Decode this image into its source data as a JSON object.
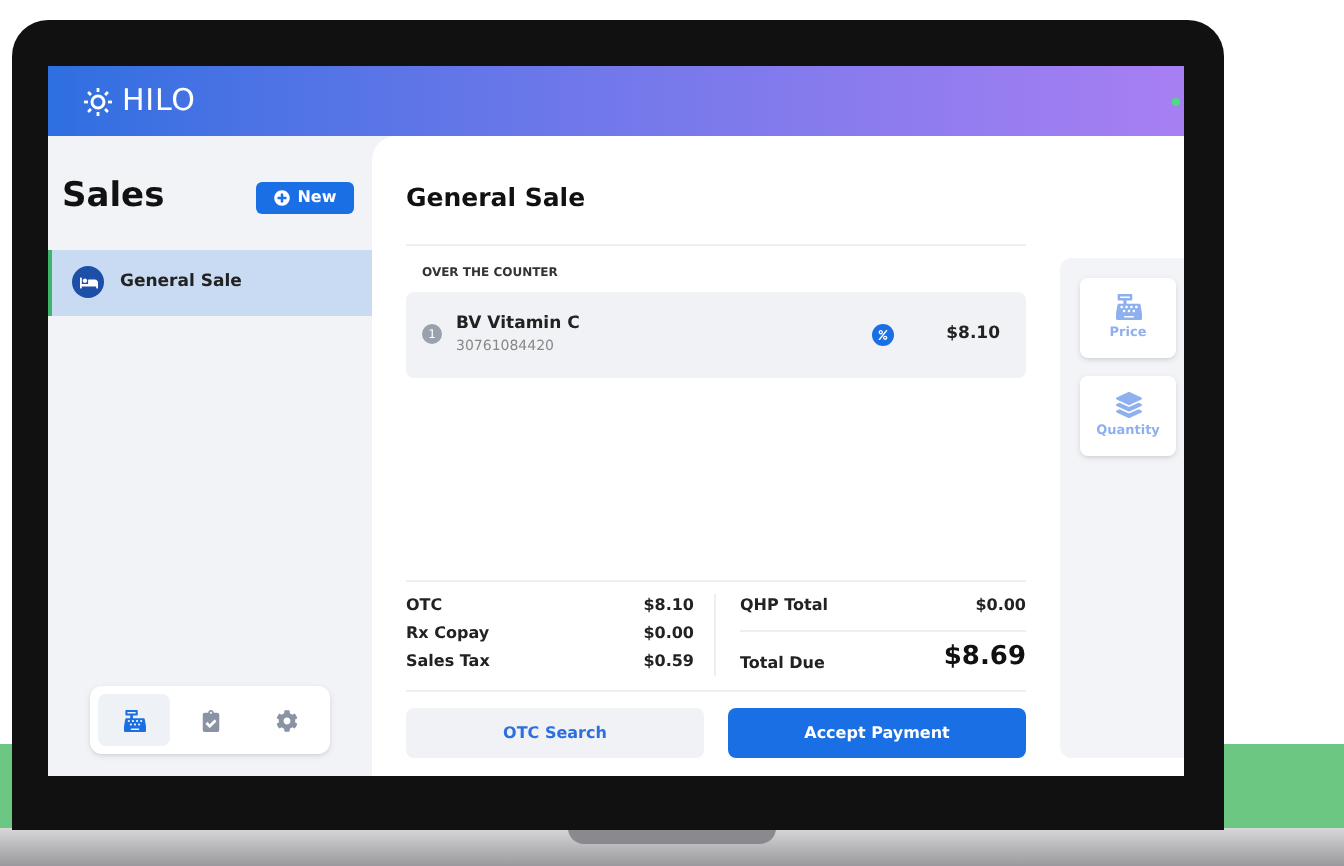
{
  "header": {
    "logo": "HILO"
  },
  "sidebar": {
    "title": "Sales",
    "new_button": "New",
    "items": [
      {
        "label": "General Sale",
        "selected": true
      }
    ],
    "nav": [
      {
        "kind": "register",
        "selected": true
      },
      {
        "kind": "clipboard",
        "selected": false
      },
      {
        "kind": "settings",
        "selected": false
      }
    ]
  },
  "main": {
    "title": "General Sale",
    "section_label": "OVER THE COUNTER",
    "line_items": [
      {
        "qty": "1",
        "name": "BV Vitamin C",
        "code": "30761084420",
        "price": "$8.10",
        "discount": true
      }
    ],
    "summary_left": [
      {
        "label": "OTC",
        "value": "$8.10"
      },
      {
        "label": "Rx Copay",
        "value": "$0.00"
      },
      {
        "label": "Sales Tax",
        "value": "$0.59"
      }
    ],
    "qhp_total": {
      "label": "QHP Total",
      "value": "$0.00"
    },
    "total_due": {
      "label": "Total Due",
      "value": "$8.69"
    },
    "buttons": [
      {
        "label": "OTC Search",
        "kind": "secondary"
      },
      {
        "label": "Accept Payment",
        "kind": "primary"
      }
    ],
    "actions": [
      {
        "label": "Price",
        "kind": "price"
      },
      {
        "label": "Quantity",
        "kind": "quantity"
      }
    ]
  }
}
